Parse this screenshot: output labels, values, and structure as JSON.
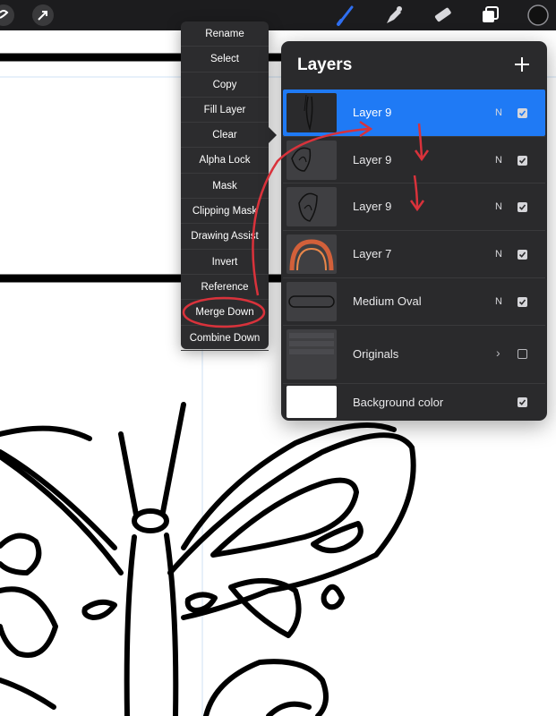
{
  "toolbar": {
    "icons": [
      "modify-icon",
      "selection-arrow-icon",
      "brush-icon",
      "smudge-icon",
      "eraser-icon",
      "layers-icon",
      "color-swatch"
    ],
    "active_color": "#111111",
    "tool_accent": "#2f6ff0"
  },
  "layer_menu": {
    "items": [
      "Rename",
      "Select",
      "Copy",
      "Fill Layer",
      "Clear",
      "Alpha Lock",
      "Mask",
      "Clipping Mask",
      "Drawing Assist",
      "Invert",
      "Reference",
      "Merge Down",
      "Combine Down"
    ]
  },
  "layers_panel": {
    "title": "Layers",
    "add_icon": "plus-icon",
    "layers": [
      {
        "name": "Layer 9",
        "blend": "N",
        "visible": true,
        "selected": true
      },
      {
        "name": "Layer 9",
        "blend": "N",
        "visible": true,
        "selected": false
      },
      {
        "name": "Layer 9",
        "blend": "N",
        "visible": true,
        "selected": false
      },
      {
        "name": "Layer 7",
        "blend": "N",
        "visible": true,
        "selected": false
      },
      {
        "name": "Medium Oval",
        "blend": "N",
        "visible": true,
        "selected": false
      },
      {
        "name": "Originals",
        "blend": "",
        "visible": false,
        "selected": false,
        "group": true
      },
      {
        "name": "Background color",
        "blend": "",
        "visible": true,
        "selected": false
      }
    ]
  },
  "colors": {
    "selection_blue": "#1f7af5",
    "annotation_red": "#d9323b",
    "panel_bg": "#2a2a2c",
    "menu_bg": "#2c2c2e"
  }
}
